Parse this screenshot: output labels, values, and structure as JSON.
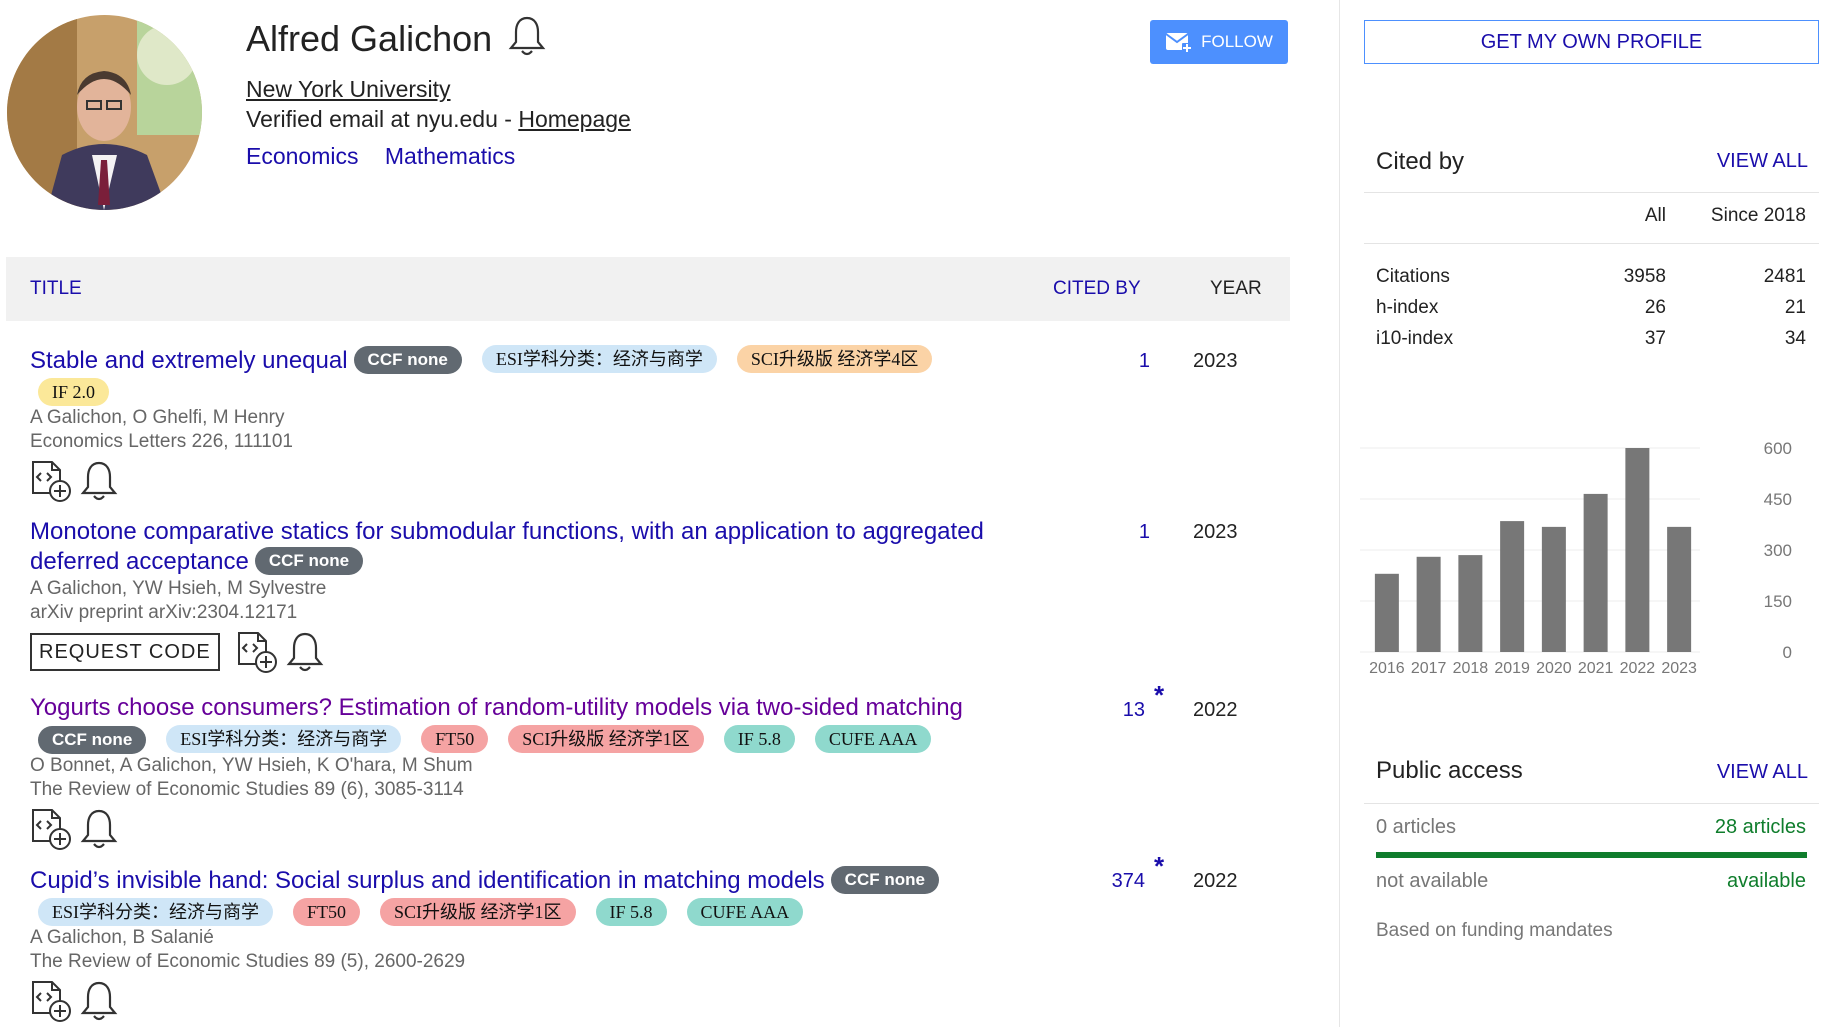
{
  "profile": {
    "name": "Alfred Galichon",
    "affiliation": "New York University",
    "email_prefix": "Verified email at nyu.edu - ",
    "homepage_label": "Homepage",
    "interests": [
      "Economics",
      "Mathematics"
    ],
    "follow_label": "FOLLOW"
  },
  "table": {
    "header_title": "TITLE",
    "header_cited": "CITED BY",
    "header_year": "YEAR"
  },
  "articles": [
    {
      "title": "Stable and extremely unequal",
      "badges": [
        "CCF none",
        "ESI学科分类：经济与商学",
        "SCI升级版 经济学4区",
        "IF 2.0"
      ],
      "authors": "A Galichon, O Ghelfi, M Henry",
      "venue": "Economics Letters 226, 111101",
      "cited_by": "1",
      "year": "2023"
    },
    {
      "title": "Monotone comparative statics for submodular functions, with an application to aggregated deferred acceptance",
      "badges": [
        "CCF none"
      ],
      "authors": "A Galichon, YW Hsieh, M Sylvestre",
      "venue": "arXiv preprint arXiv:2304.12171",
      "request_code": "REQUEST CODE",
      "cited_by": "1",
      "year": "2023"
    },
    {
      "title": "Yogurts choose consumers? Estimation of random-utility models via two-sided matching",
      "badges": [
        "CCF none",
        "ESI学科分类：经济与商学",
        "FT50",
        "SCI升级版 经济学1区",
        "IF 5.8",
        "CUFE AAA"
      ],
      "authors": "O Bonnet, A Galichon, YW Hsieh, K O'hara, M Shum",
      "venue": "The Review of Economic Studies 89 (6), 3085-3114",
      "cited_by": "13",
      "star": "*",
      "year": "2022"
    },
    {
      "title": "Cupid’s invisible hand: Social surplus and identification in matching models",
      "badges": [
        "CCF none",
        "ESI学科分类：经济与商学",
        "FT50",
        "SCI升级版 经济学1区",
        "IF 5.8",
        "CUFE AAA"
      ],
      "authors": "A Galichon, B Salanié",
      "venue": "The Review of Economic Studies 89 (5), 2600-2629",
      "cited_by": "374",
      "star": "*",
      "year": "2022"
    }
  ],
  "sidebar": {
    "own_profile_label": "GET MY OWN PROFILE",
    "cited_by": {
      "title": "Cited by",
      "view_all": "VIEW ALL",
      "col_all": "All",
      "col_since": "Since 2018",
      "rows": [
        {
          "label": "Citations",
          "all": "3958",
          "since": "2481"
        },
        {
          "label": "h-index",
          "all": "26",
          "since": "21"
        },
        {
          "label": "i10-index",
          "all": "37",
          "since": "34"
        }
      ]
    },
    "public_access": {
      "title": "Public access",
      "view_all": "VIEW ALL",
      "not_available_count": "0 articles",
      "available_count": "28 articles",
      "not_available_label": "not available",
      "available_label": "available",
      "available_fraction": 1.0,
      "note": "Based on funding mandates"
    }
  },
  "chart_data": {
    "type": "bar",
    "categories": [
      "2016",
      "2017",
      "2018",
      "2019",
      "2020",
      "2021",
      "2022",
      "2023"
    ],
    "values": [
      230,
      280,
      285,
      385,
      368,
      465,
      600,
      368
    ],
    "ylim": [
      0,
      600
    ],
    "yticks": [
      "0",
      "150",
      "300",
      "450",
      "600"
    ],
    "bar_color": "#777777"
  },
  "colors": {
    "link": "#1a0dab",
    "visited": "#660099",
    "follow_bg": "#4d90fe",
    "access_bar": "#0f7d2c"
  }
}
